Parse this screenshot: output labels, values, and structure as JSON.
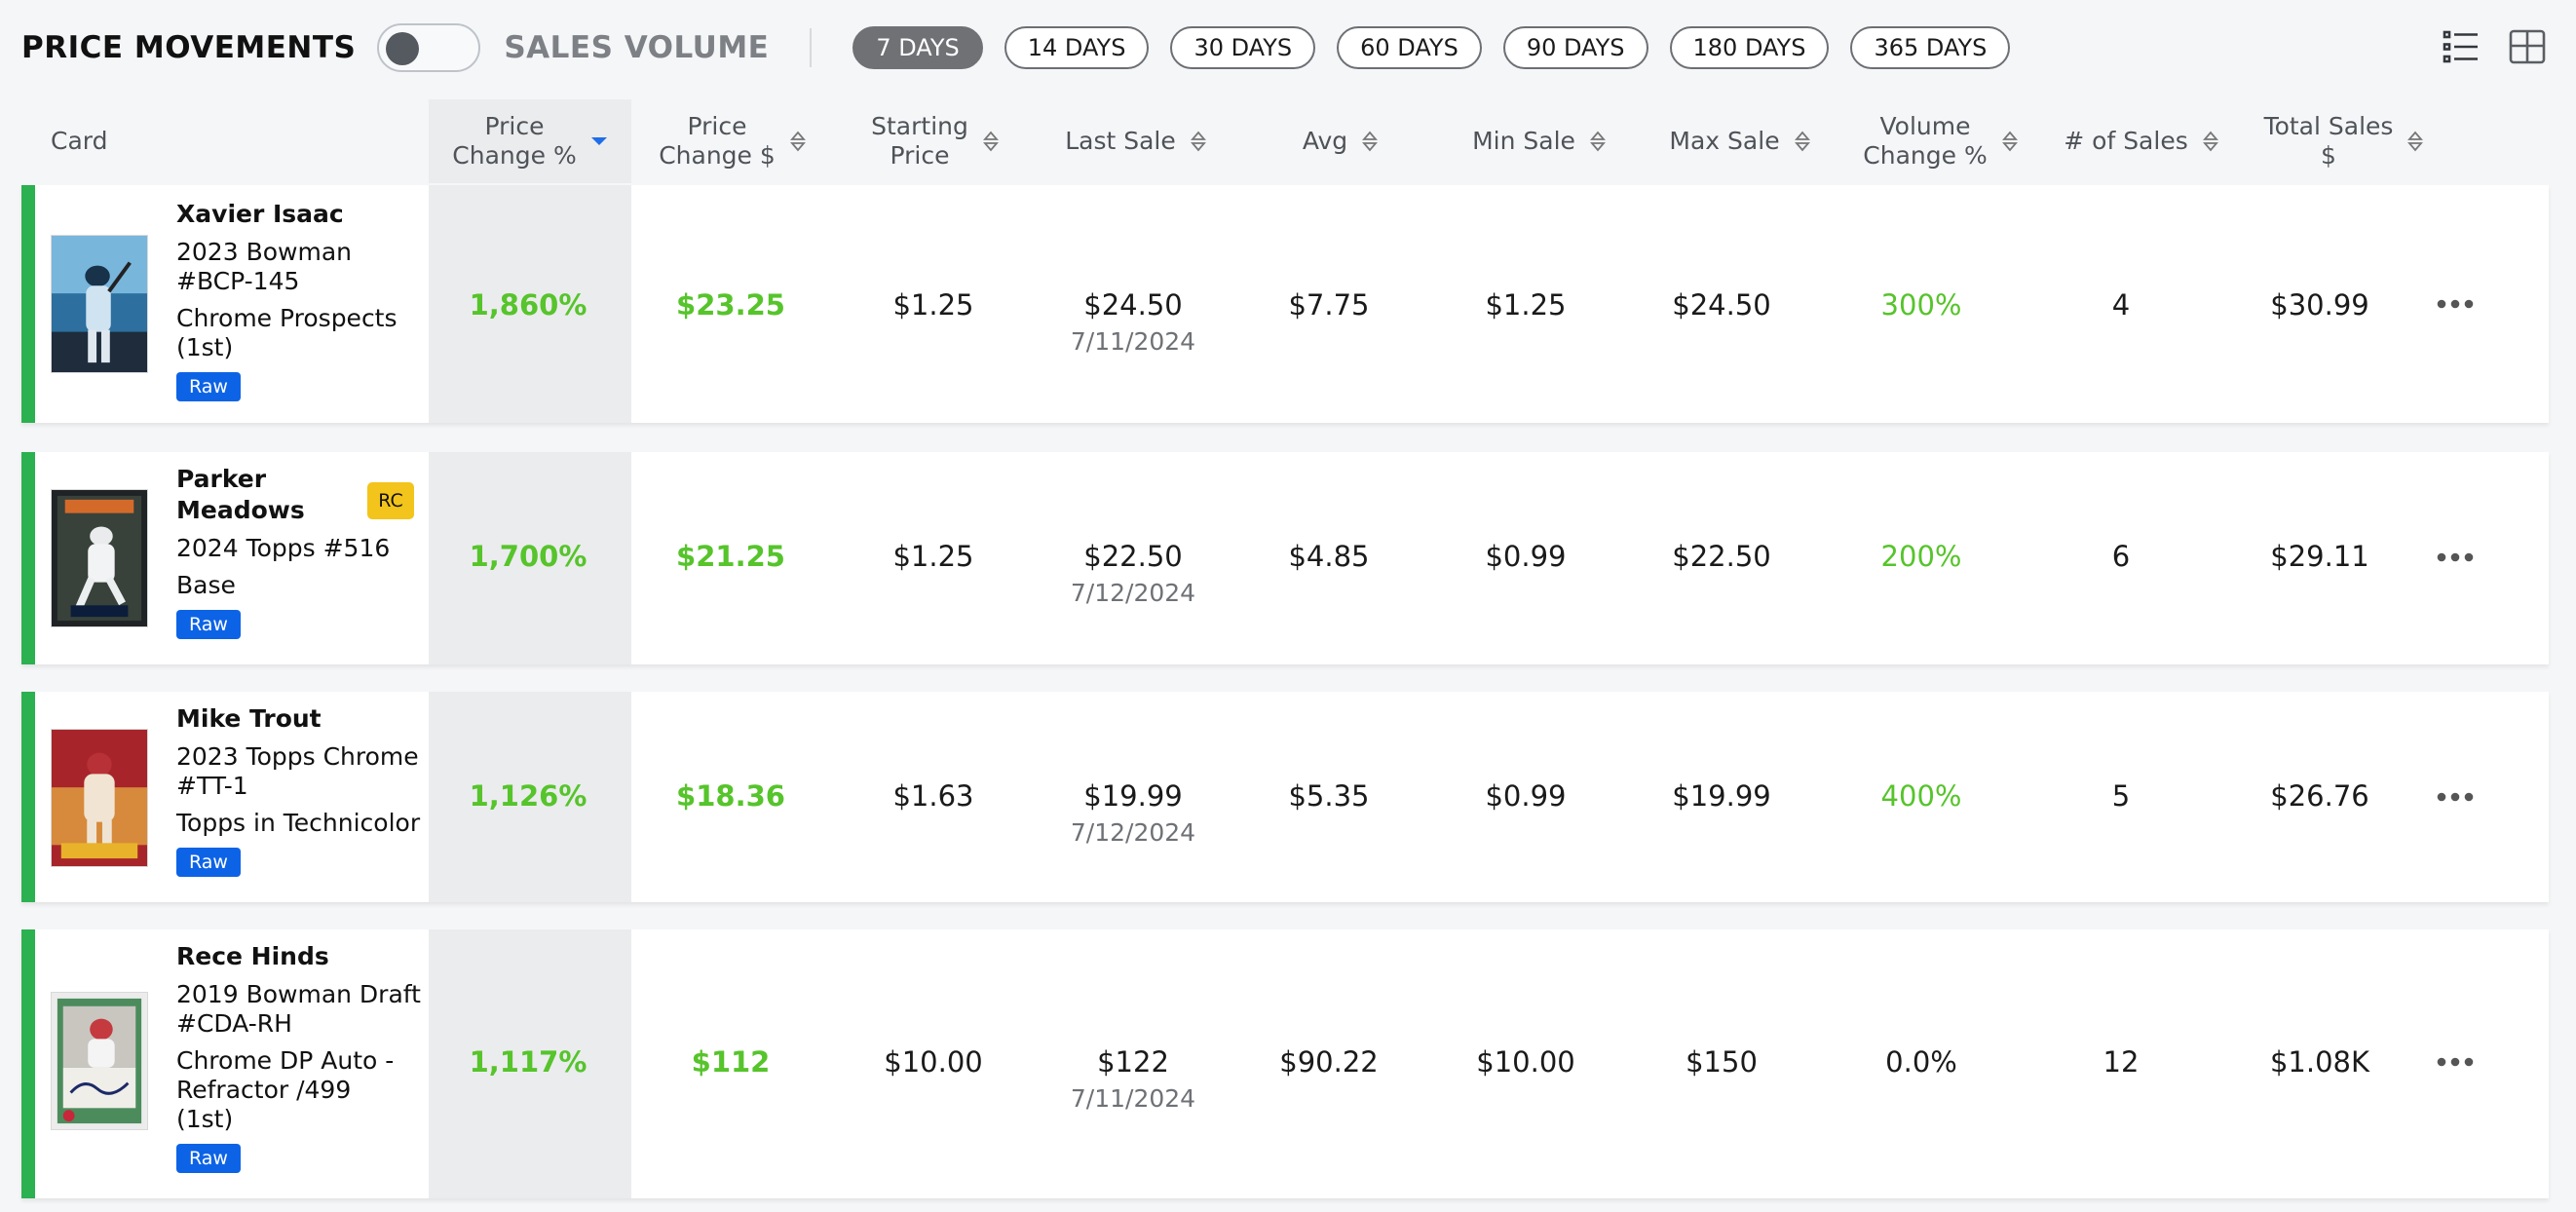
{
  "topbar": {
    "mode_left": "PRICE MOVEMENTS",
    "mode_right": "SALES VOLUME",
    "ranges": [
      "7 DAYS",
      "14 DAYS",
      "30 DAYS",
      "60 DAYS",
      "90 DAYS",
      "180 DAYS",
      "365 DAYS"
    ],
    "active_range": "7 DAYS",
    "view_icons": [
      "list-view-icon",
      "grid-view-icon"
    ]
  },
  "header": {
    "card": "Card",
    "price_change_pct": "Price\nChange %",
    "price_change_usd": "Price\nChange $",
    "starting_price": "Starting\nPrice",
    "last_sale": "Last Sale",
    "avg": "Avg",
    "min_sale": "Min Sale",
    "max_sale": "Max Sale",
    "volume_change_pct": "Volume\nChange %",
    "num_sales": "# of Sales",
    "total_sales": "Total Sales\n$"
  },
  "rows": [
    {
      "player": "Xavier Isaac",
      "set": "2023 Bowman\n#BCP-145",
      "variant": "Chrome Prospects\n(1st)",
      "badge": "Raw",
      "rc": "",
      "price_change_pct": "1,860%",
      "price_change_usd": "$23.25",
      "starting_price": "$1.25",
      "last_sale": "$24.50",
      "last_sale_date": "7/11/2024",
      "avg": "$7.75",
      "min_sale": "$1.25",
      "max_sale": "$24.50",
      "volume_change_pct": "300%",
      "num_sales": "4",
      "total_sales": "$30.99"
    },
    {
      "player": "Parker\nMeadows",
      "set": "2024 Topps #516",
      "variant": "Base",
      "badge": "Raw",
      "rc": "RC",
      "price_change_pct": "1,700%",
      "price_change_usd": "$21.25",
      "starting_price": "$1.25",
      "last_sale": "$22.50",
      "last_sale_date": "7/12/2024",
      "avg": "$4.85",
      "min_sale": "$0.99",
      "max_sale": "$22.50",
      "volume_change_pct": "200%",
      "num_sales": "6",
      "total_sales": "$29.11"
    },
    {
      "player": "Mike Trout",
      "set": "2023 Topps Chrome\n#TT-1",
      "variant": "Topps in Technicolor",
      "badge": "Raw",
      "rc": "",
      "price_change_pct": "1,126%",
      "price_change_usd": "$18.36",
      "starting_price": "$1.63",
      "last_sale": "$19.99",
      "last_sale_date": "7/12/2024",
      "avg": "$5.35",
      "min_sale": "$0.99",
      "max_sale": "$19.99",
      "volume_change_pct": "400%",
      "num_sales": "5",
      "total_sales": "$26.76"
    },
    {
      "player": "Rece Hinds",
      "set": "2019 Bowman Draft\n#CDA-RH",
      "variant": "Chrome DP Auto -\nRefractor /499\n(1st)",
      "badge": "Raw",
      "rc": "",
      "price_change_pct": "1,117%",
      "price_change_usd": "$112",
      "starting_price": "$10.00",
      "last_sale": "$122",
      "last_sale_date": "7/11/2024",
      "avg": "$90.22",
      "min_sale": "$10.00",
      "max_sale": "$150",
      "volume_change_pct": "0.0%",
      "num_sales": "12",
      "total_sales": "$1.08K"
    }
  ],
  "colors": {
    "positive": "#56c42b",
    "stripe": "#2bb14f",
    "raw_badge": "#0d63e6",
    "rc_badge": "#f3c41b"
  }
}
